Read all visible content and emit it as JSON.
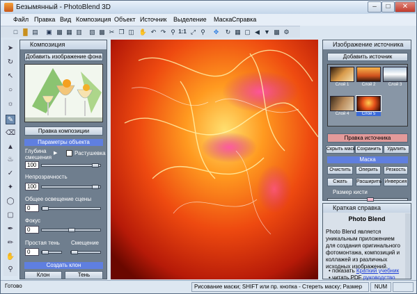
{
  "window": {
    "title": "Безымянный - PhotoBlend 3D"
  },
  "menu": [
    "Файл",
    "Правка",
    "Вид",
    "Композиция",
    "Объект",
    "Источник",
    "Выделение",
    "Маска",
    "Справка"
  ],
  "toolbar": {
    "zoom_label": "1:1"
  },
  "composition_panel": {
    "title": "Композиция",
    "add_bg_button": "Добавить изображение фона",
    "edit_button": "Правка композиции",
    "object_params": "Параметры объекта",
    "depth_label": "Глубина смешения",
    "feather_label": "Растушевка",
    "depth_value": "100",
    "opacity_label": "Непрозрачность",
    "opacity_value": "100",
    "lighting_label": "Общее освещение сцены",
    "lighting_value": "0",
    "focus_label": "Фокус",
    "focus_value": "0",
    "shadow_label": "Простая тень",
    "offset_label": "Смещение",
    "shadow_value": "0",
    "create_clone": "Создать клон",
    "clone_button": "Клон",
    "shadow_button": "Тень"
  },
  "source_panel": {
    "title": "Изображение источника",
    "add_source": "Добавить источник",
    "thumbs": [
      "Слой 1",
      "Слой 2",
      "Слой 3",
      "Слой 4",
      "Слой 5"
    ],
    "edit_source": "Правка источника",
    "hide_mask": "Скрыть маску",
    "save": "Сохранить",
    "delete": "Удалить",
    "mask_section": "Маска",
    "clear": "Очистить",
    "cut": "Оперить",
    "sharpness": "Резкость",
    "shrink": "Сжать",
    "expand": "Расширить",
    "invert": "Инверсия",
    "brush_size": "Размер кисти"
  },
  "help_panel": {
    "title": "Краткая справка",
    "heading": "Photo Blend",
    "body": "Photo Blend является уникальным приложением для создания оригинального фотомонтажа, композиций и коллажей из различных исходных изображений.",
    "item1_prefix": "показать",
    "item1_link": "Краткий учебник",
    "item2_prefix": "читать PDF",
    "item2_link": "руководство"
  },
  "status": {
    "ready": "Готово",
    "hint": "Рисование маски; SHIFT или пр. кнопка - Стереть маску; Размер",
    "num": "NUM"
  },
  "colors": {
    "section_blue": "#5f7fe0",
    "source_edit": "#e39a9a",
    "panel_bg": "#6f7e8e"
  }
}
